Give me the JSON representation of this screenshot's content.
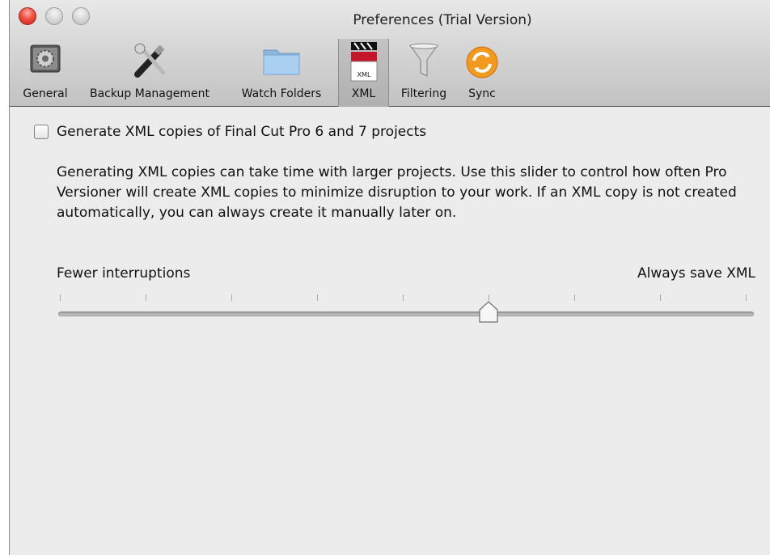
{
  "window": {
    "title": "Preferences (Trial Version)"
  },
  "toolbar": {
    "items": [
      {
        "label": "General",
        "icon": "general-gear-icon",
        "selected": false
      },
      {
        "label": "Backup Management",
        "icon": "tools-icon",
        "selected": false
      },
      {
        "label": "Watch Folders",
        "icon": "folder-icon",
        "selected": false
      },
      {
        "label": "XML",
        "icon": "xml-clapper-icon",
        "selected": true
      },
      {
        "label": "Filtering",
        "icon": "funnel-icon",
        "selected": false
      },
      {
        "label": "Sync",
        "icon": "sync-icon",
        "selected": false
      }
    ]
  },
  "xml": {
    "generate_checkbox": {
      "label": "Generate XML copies of Final Cut Pro 6 and 7 projects",
      "checked": false
    },
    "description": "Generating XML copies can take time with larger projects. Use this slider to control how often Pro Versioner will create XML copies to minimize disruption to your work. If an XML copy is not created automatically, you can always create it manually later on.",
    "slider": {
      "min_label": "Fewer interruptions",
      "max_label": "Always save XML",
      "tick_count": 9,
      "value_fraction": 0.625
    }
  },
  "icon_text": {
    "xml_badge": "XML"
  },
  "colors": {
    "close_button": "#f24f43",
    "sync_orange": "#f39a1e",
    "folder_blue": "#9ec7ea"
  }
}
